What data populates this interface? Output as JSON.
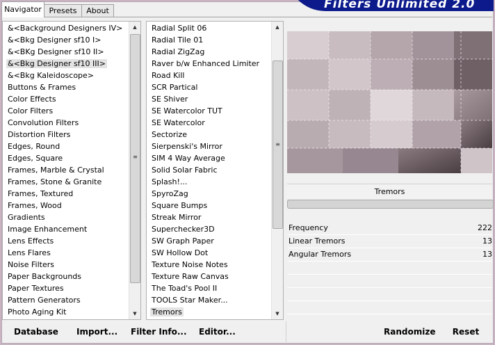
{
  "tabs": [
    "Navigator",
    "Presets",
    "About"
  ],
  "banner_title": "Filters Unlimited 2.0",
  "categories": [
    "&<Background Designers IV>",
    "&<Bkg Designer sf10 I>",
    "&<BKg Designer sf10 II>",
    "&<Bkg Designer sf10 III>",
    "&<Bkg Kaleidoscope>",
    "Buttons & Frames",
    "Color Effects",
    "Color Filters",
    "Convolution Filters",
    "Distortion Filters",
    "Edges, Round",
    "Edges, Square",
    "Frames, Marble & Crystal",
    "Frames, Stone & Granite",
    "Frames, Textured",
    "Frames, Wood",
    "Gradients",
    "Image Enhancement",
    "Lens Effects",
    "Lens Flares",
    "Noise Filters",
    "Paper Backgrounds",
    "Paper Textures",
    "Pattern Generators",
    "Photo Aging Kit"
  ],
  "selected_category": "&<Bkg Designer sf10 III>",
  "filters": [
    "Radial Split 06",
    "Radial Tile 01",
    "Radial ZigZag",
    "Raver b/w Enhanced Limiter",
    "Road Kill",
    "SCR  Partical",
    "SE Shiver",
    "SE Watercolor TUT",
    "SE Watercolor",
    "Sectorize",
    "Sierpenski's Mirror",
    "SIM 4 Way Average",
    "Solid Solar Fabric",
    "Splash!...",
    "SpyroZag",
    "Square Bumps",
    "Streak Mirror",
    "Superchecker3D",
    "SW Graph Paper",
    "SW Hollow Dot",
    "Texture Noise Notes",
    "Texture Raw Canvas",
    "The Toad's Pool II",
    "TOOLS Star Maker...",
    "Tremors"
  ],
  "selected_filter": "Tremors",
  "current_filter_name": "Tremors",
  "parameters": [
    {
      "label": "Frequency",
      "value": "222"
    },
    {
      "label": "Linear Tremors",
      "value": "13"
    },
    {
      "label": "Angular Tremors",
      "value": "13"
    }
  ],
  "buttons": {
    "database": "Database",
    "import": "Import...",
    "filter_info": "Filter Info...",
    "editor": "Editor...",
    "randomize": "Randomize",
    "reset": "Reset"
  },
  "colors": {
    "banner": "#0c1a8c",
    "frame": "#c9b4c3"
  }
}
